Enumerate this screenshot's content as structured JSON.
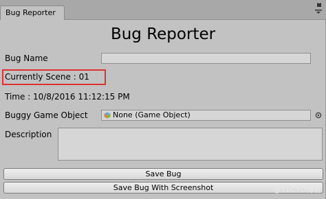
{
  "tab": {
    "label": "Bug Reporter"
  },
  "title": "Bug Reporter",
  "fields": {
    "bug_name_label": "Bug Name",
    "bug_name_value": "",
    "scene_text": "Currently Scene : 01",
    "time_text": "Time : 10/8/2016 11:12:15 PM",
    "buggy_object_label": "Buggy Game Object",
    "buggy_object_value": "None (Game Object)",
    "description_label": "Description",
    "description_value": ""
  },
  "buttons": {
    "save_bug": "Save Bug",
    "save_bug_screenshot": "Save Bug With Screenshot"
  },
  "watermark": "@51CTO博客",
  "colors": {
    "highlight": "#e03030",
    "panel": "#c2c2c2"
  }
}
